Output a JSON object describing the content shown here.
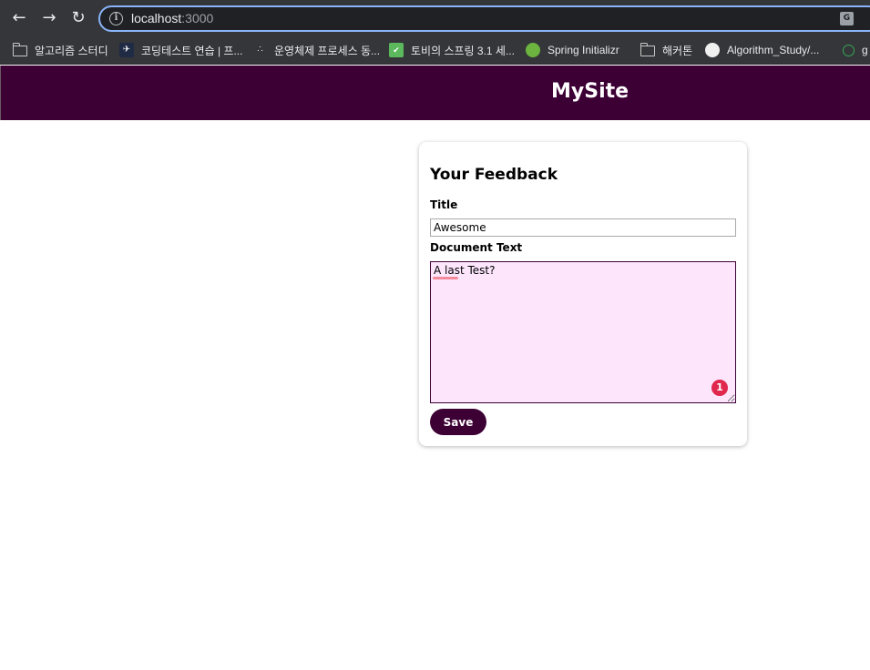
{
  "browser": {
    "url_host": "localhost",
    "url_port": ":3000",
    "bookmarks": [
      {
        "label": "알고리즘 스터디",
        "icon": "folder-icon"
      },
      {
        "label": "코딩테스트 연습 | 프...",
        "icon": "programmers-icon"
      },
      {
        "label": "운영체제 프로세스 동...",
        "icon": "tistory-icon"
      },
      {
        "label": "토비의 스프링 3.1 세...",
        "icon": "book-icon"
      },
      {
        "label": "Spring Initializr",
        "icon": "spring-icon"
      },
      {
        "label": "해커톤",
        "icon": "folder-icon"
      },
      {
        "label": "Algorithm_Study/...",
        "icon": "github-icon"
      },
      {
        "label": "g",
        "icon": "globe-icon"
      }
    ]
  },
  "site": {
    "title": "MySite"
  },
  "feedback": {
    "heading": "Your Feedback",
    "title_label": "Title",
    "title_value": "Awesome",
    "text_label": "Document Text",
    "text_value": "A last Test?",
    "issue_count": "1",
    "save_label": "Save"
  },
  "colors": {
    "brand": "#3c0034",
    "textarea_bg": "#fde6fc",
    "badge": "#e0274e"
  }
}
